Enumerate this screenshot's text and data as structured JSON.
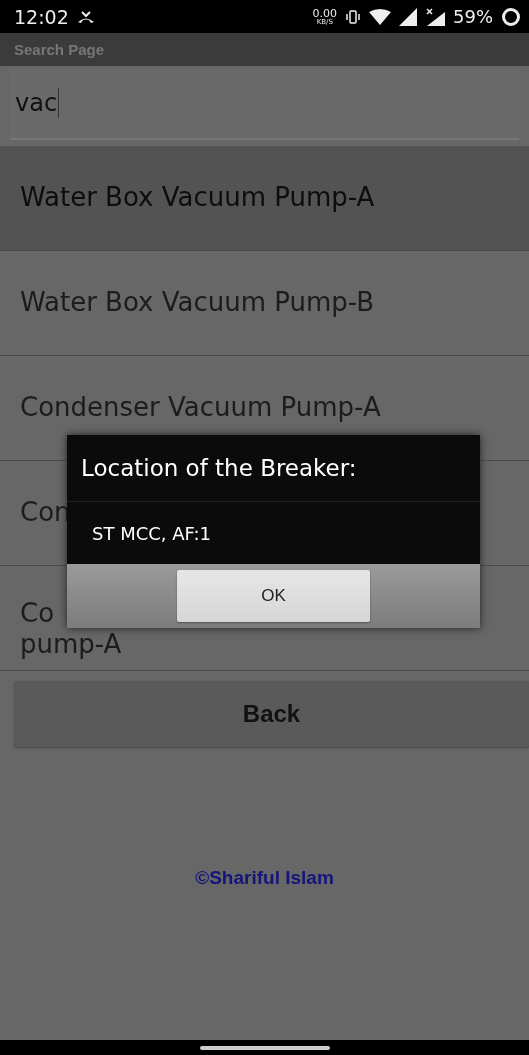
{
  "status_bar": {
    "time": "12:02",
    "speed_value": "0.00",
    "speed_unit": "KB/S",
    "battery": "59%"
  },
  "title_bar": {
    "title": "Search Page"
  },
  "search": {
    "value": "vac"
  },
  "results": [
    {
      "lines": [
        "Water Box Vacuum Pump-A"
      ],
      "selected": true
    },
    {
      "lines": [
        "Water Box Vacuum Pump-B"
      ],
      "selected": false
    },
    {
      "lines": [
        "Condenser Vacuum Pump-A"
      ],
      "selected": false
    },
    {
      "lines": [
        "Con"
      ],
      "selected": false
    },
    {
      "lines": [
        "Co",
        "pump-A"
      ],
      "selected": false
    }
  ],
  "back_button": "Back",
  "footer": "©Shariful Islam",
  "dialog": {
    "title": "Location of the Breaker:",
    "message": "ST MCC, AF:1",
    "button": "OK"
  }
}
